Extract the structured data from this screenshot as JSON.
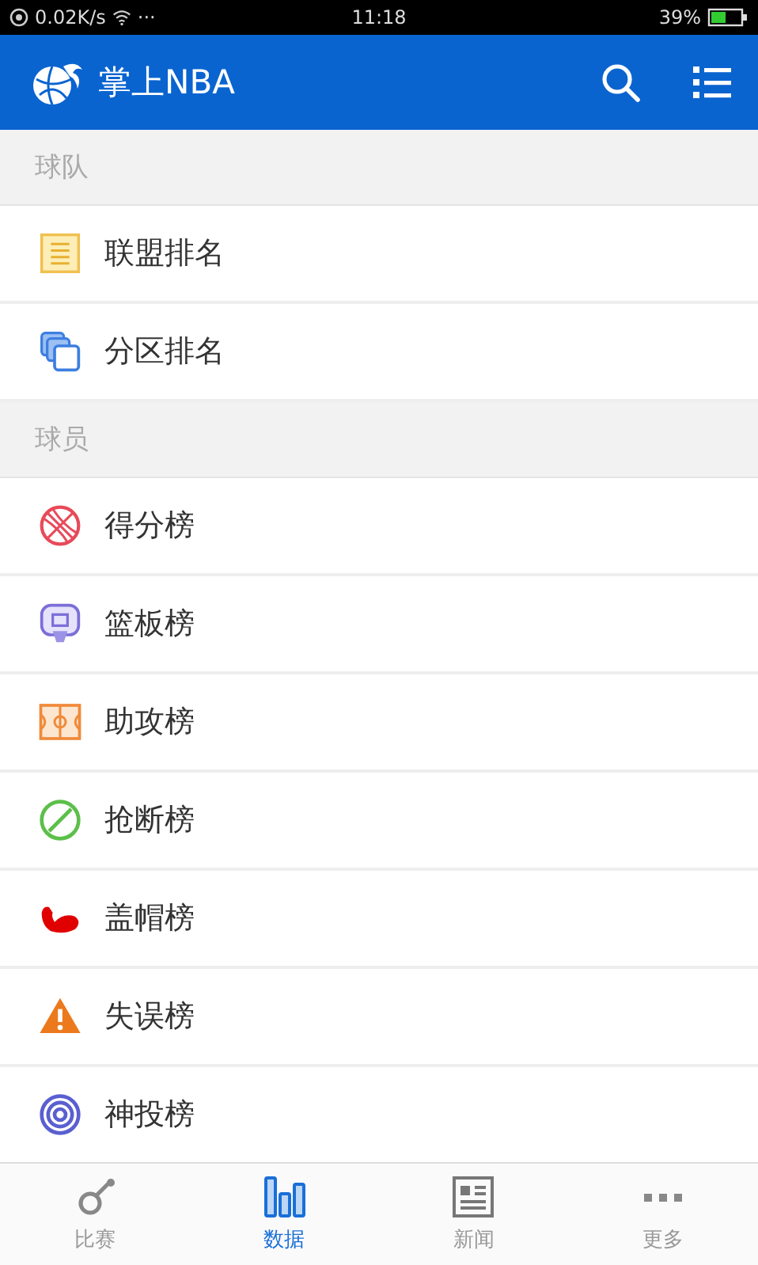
{
  "status_bar": {
    "speed": "0.02K/s",
    "dots": "···",
    "time": "11:18",
    "battery": "39%"
  },
  "header": {
    "title": "掌上NBA"
  },
  "sections": [
    {
      "title": "球队",
      "items": [
        {
          "label": "联盟排名"
        },
        {
          "label": "分区排名"
        }
      ]
    },
    {
      "title": "球员",
      "items": [
        {
          "label": "得分榜"
        },
        {
          "label": "篮板榜"
        },
        {
          "label": "助攻榜"
        },
        {
          "label": "抢断榜"
        },
        {
          "label": "盖帽榜"
        },
        {
          "label": "失误榜"
        },
        {
          "label": "神投榜"
        }
      ]
    }
  ],
  "tabs": [
    {
      "label": "比赛",
      "selected": false
    },
    {
      "label": "数据",
      "selected": true
    },
    {
      "label": "新闻",
      "selected": false
    },
    {
      "label": "更多",
      "selected": false
    }
  ]
}
